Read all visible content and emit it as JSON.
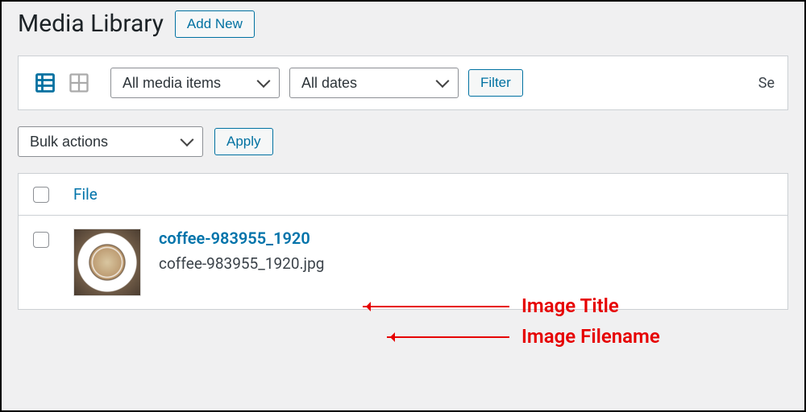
{
  "header": {
    "title": "Media Library",
    "add_new": "Add New"
  },
  "toolbar": {
    "media_filter": "All media items",
    "date_filter": "All dates",
    "filter_btn": "Filter",
    "search_cut": "Se"
  },
  "bulk": {
    "select": "Bulk actions",
    "apply": "Apply"
  },
  "table": {
    "col_file": "File",
    "rows": [
      {
        "title": "coffee-983955_1920",
        "filename": "coffee-983955_1920.jpg"
      }
    ]
  },
  "annotations": {
    "title": "Image Title",
    "filename": "Image Filename"
  }
}
